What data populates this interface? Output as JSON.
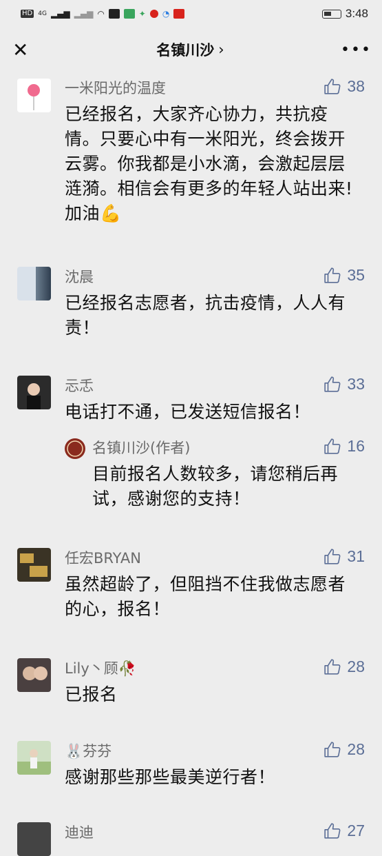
{
  "status_bar": {
    "time": "3:48",
    "hd_label": "HD",
    "network_label": "4G"
  },
  "nav": {
    "title": "名镇川沙",
    "chevron": "›",
    "more": "•••"
  },
  "comments": [
    {
      "name": "一米阳光的温度",
      "likes": "38",
      "text": "已经报名，大家齐心协力，共抗疫情。只要心中有一米阳光，终会拨开云雾。你我都是小水滴，会激起层层涟漪。相信会有更多的年轻人站出来!加油💪"
    },
    {
      "name": "沈晨",
      "likes": "35",
      "text": "已经报名志愿者，抗击疫情，人人有责！"
    },
    {
      "name": "忈忎",
      "likes": "33",
      "text": "电话打不通，已发送短信报名！"
    },
    {
      "name": "名镇川沙(作者)",
      "likes": "16",
      "text": "目前报名人数较多，请您稍后再试，感谢您的支持！"
    },
    {
      "name": "任宏BRYAN",
      "likes": "31",
      "text": "虽然超龄了，但阻挡不住我做志愿者的心，报名！"
    },
    {
      "name": "Lily丶顾🥀",
      "likes": "28",
      "text": "已报名"
    },
    {
      "name": "🐰芬芬",
      "likes": "28",
      "text": "感谢那些那些最美逆行者！"
    },
    {
      "name": "迪迪",
      "likes": "27",
      "text": ""
    }
  ],
  "colors": {
    "background": "#ededed",
    "like_blue": "#5b6e96",
    "name_gray": "#6a6a6a"
  }
}
